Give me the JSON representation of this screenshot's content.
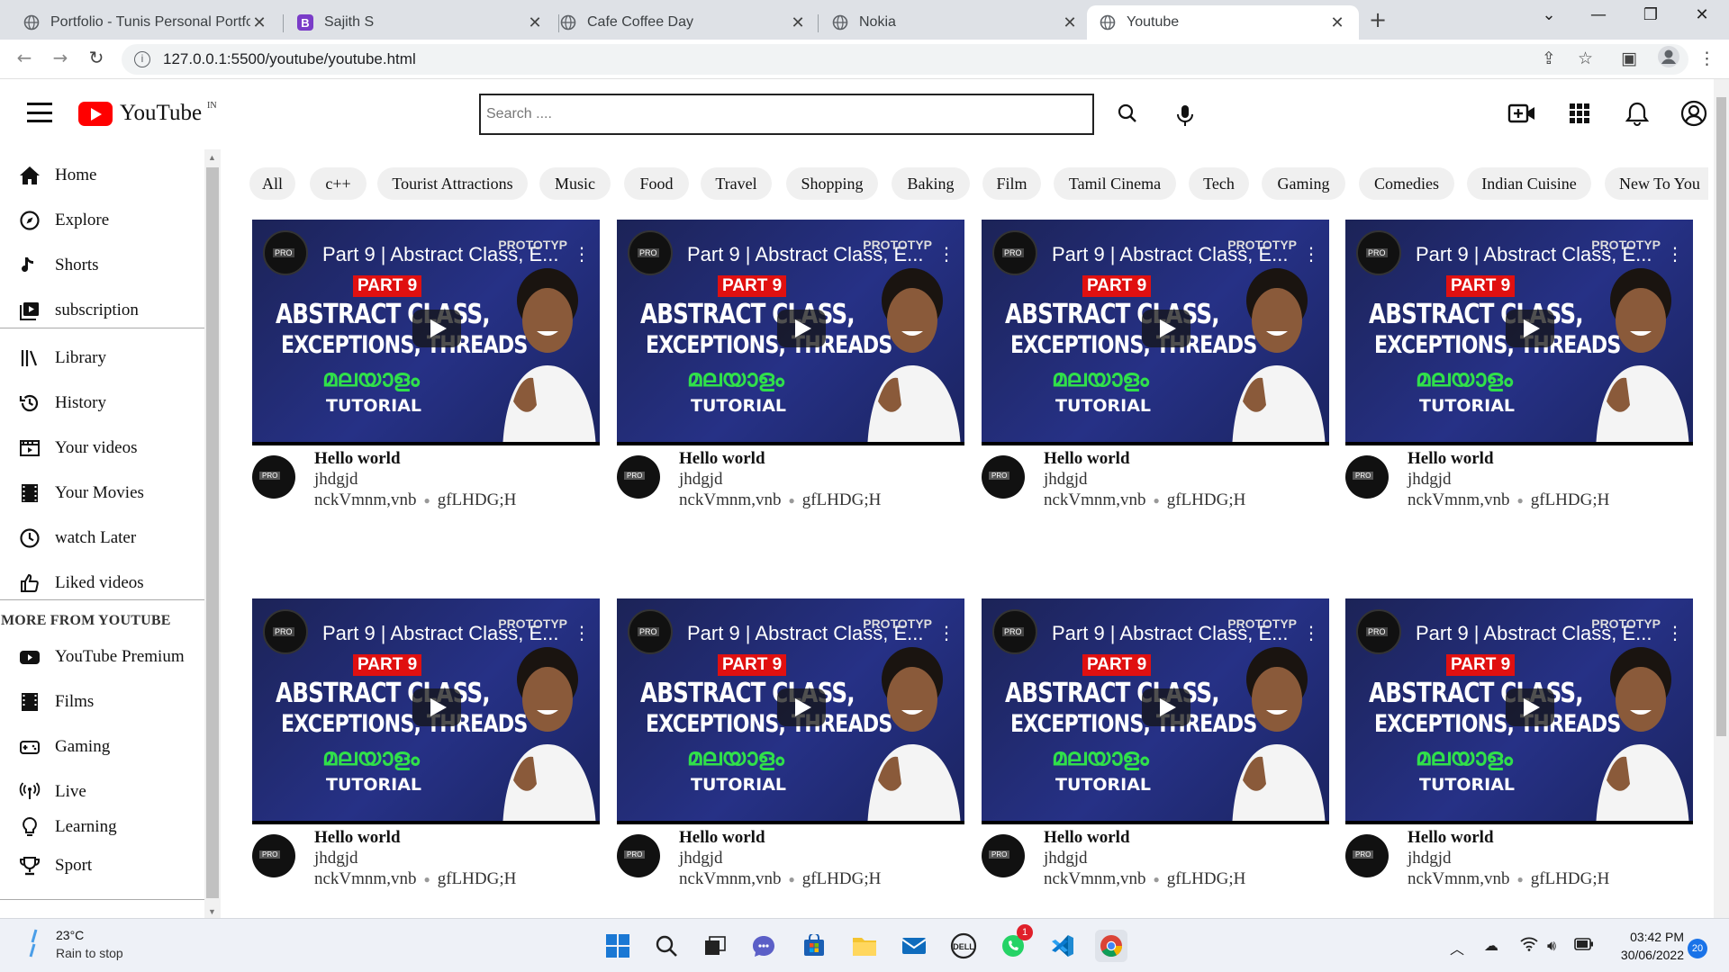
{
  "browser": {
    "tabs": [
      {
        "title": "Portfolio - Tunis Personal Portfoli",
        "icon": "globe-icon"
      },
      {
        "title": "Sajith S",
        "icon": "bootstrap-icon"
      },
      {
        "title": "Cafe Coffee Day",
        "icon": "globe-icon"
      },
      {
        "title": "Nokia",
        "icon": "globe-icon"
      },
      {
        "title": "Youtube",
        "icon": "globe-icon"
      }
    ],
    "active_tab": 4,
    "url": "127.0.0.1:5500/youtube/youtube.html"
  },
  "header": {
    "logo_text": "YouTube",
    "country_code": "IN",
    "search_placeholder": "Search ....",
    "brand_color": "#ff0000"
  },
  "sidebar": {
    "primary": [
      {
        "label": "Home",
        "icon": "home-icon"
      },
      {
        "label": "Explore",
        "icon": "compass-icon"
      },
      {
        "label": "Shorts",
        "icon": "shorts-icon"
      },
      {
        "label": "subscription",
        "icon": "subscription-icon"
      }
    ],
    "library": [
      {
        "label": "Library",
        "icon": "library-icon"
      },
      {
        "label": "History",
        "icon": "history-icon"
      },
      {
        "label": "Your videos",
        "icon": "video-icon"
      },
      {
        "label": "Your Movies",
        "icon": "film-icon"
      },
      {
        "label": "watch Later",
        "icon": "clock-icon"
      },
      {
        "label": "Liked videos",
        "icon": "thumbs-up-icon"
      }
    ],
    "more_heading": "MORE FROM YOUTUBE",
    "more": [
      {
        "label": "YouTube Premium",
        "icon": "youtube-premium-icon"
      },
      {
        "label": "Films",
        "icon": "film-icon"
      },
      {
        "label": "Gaming",
        "icon": "gamepad-icon"
      },
      {
        "label": "Live",
        "icon": "live-icon"
      },
      {
        "label": "Learning",
        "icon": "lightbulb-icon"
      },
      {
        "label": "Sport",
        "icon": "trophy-icon"
      }
    ]
  },
  "chips": [
    "All",
    "c++",
    "Tourist Attractions",
    "Music",
    "Food",
    "Travel",
    "Shopping",
    "Baking",
    "Film",
    "Tamil Cinema",
    "Tech",
    "Gaming",
    "Comedies",
    "Indian Cuisine",
    "New To You"
  ],
  "thumbnail": {
    "video_title": "Part 9 | Abstract Class, E...",
    "brand": "PROTOTYP",
    "part_label": "PART 9",
    "headline_1": "ABSTRACT CLASS,",
    "headline_2": "EXCEPTIONS, THREADS",
    "language_label": "മലയാളം",
    "tutorial_label": "TUTORIAL"
  },
  "videos": [
    {
      "title": "Hello world",
      "channel": "jhdgjd",
      "views": "nckVmnm,vnb",
      "age": "gfLHDG;H"
    },
    {
      "title": "Hello world",
      "channel": "jhdgjd",
      "views": "nckVmnm,vnb",
      "age": "gfLHDG;H"
    },
    {
      "title": "Hello world",
      "channel": "jhdgjd",
      "views": "nckVmnm,vnb",
      "age": "gfLHDG;H"
    },
    {
      "title": "Hello world",
      "channel": "jhdgjd",
      "views": "nckVmnm,vnb",
      "age": "gfLHDG;H"
    },
    {
      "title": "Hello world",
      "channel": "jhdgjd",
      "views": "nckVmnm,vnb",
      "age": "gfLHDG;H"
    },
    {
      "title": "Hello world",
      "channel": "jhdgjd",
      "views": "nckVmnm,vnb",
      "age": "gfLHDG;H"
    },
    {
      "title": "Hello world",
      "channel": "jhdgjd",
      "views": "nckVmnm,vnb",
      "age": "gfLHDG;H"
    },
    {
      "title": "Hello world",
      "channel": "jhdgjd",
      "views": "nckVmnm,vnb",
      "age": "gfLHDG;H"
    }
  ],
  "taskbar": {
    "temperature": "23°C",
    "weather": "Rain to stop",
    "time": "03:42 PM",
    "date": "30/06/2022",
    "notification_count": "20",
    "whatsapp_badge": "1"
  }
}
